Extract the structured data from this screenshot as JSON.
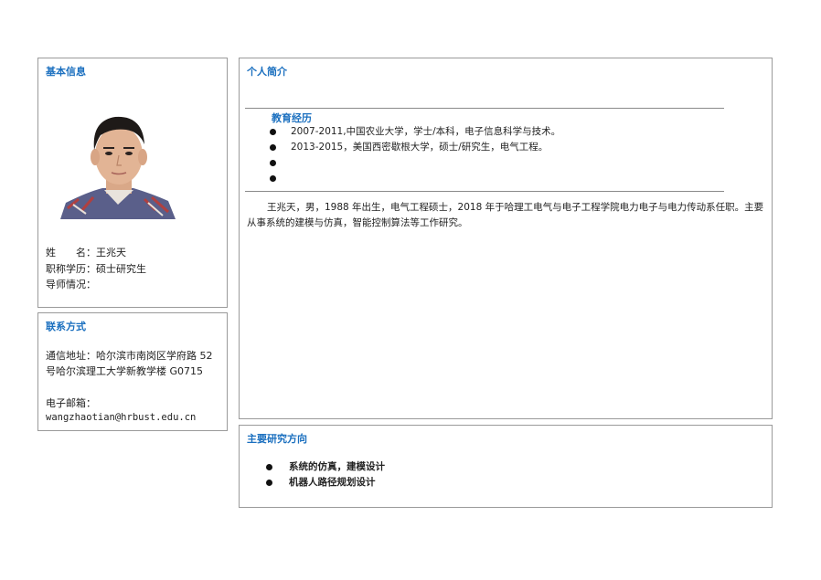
{
  "basic": {
    "title": "基本信息",
    "name_label": "姓　　名：",
    "name": "王兆天",
    "title_label": "职称学历：",
    "degree": "硕士研究生",
    "advisor_label": "导师情况：",
    "advisor": ""
  },
  "contact": {
    "title": "联系方式",
    "address_label": "通信地址：",
    "address": "哈尔滨市南岗区学府路 52号哈尔滨理工大学新教学楼 G0715",
    "email_label": "电子邮箱：",
    "email": "wangzhaotian@hrbust.edu.cn"
  },
  "intro": {
    "title": "个人简介",
    "education_title": "教育经历",
    "education": [
      "2007-2011,中国农业大学，学士/本科，电子信息科学与技术。",
      "2013-2015，美国西密歇根大学，硕士/研究生，电气工程。",
      "",
      ""
    ],
    "bio": "王兆天，男，1988 年出生，电气工程硕士，2018 年于哈理工电气与电子工程学院电力电子与电力传动系任职。主要从事系统的建模与仿真，智能控制算法等工作研究。"
  },
  "research": {
    "title": "主要研究方向",
    "items": [
      "系统的仿真，建模设计",
      "机器人路径规划设计"
    ]
  }
}
